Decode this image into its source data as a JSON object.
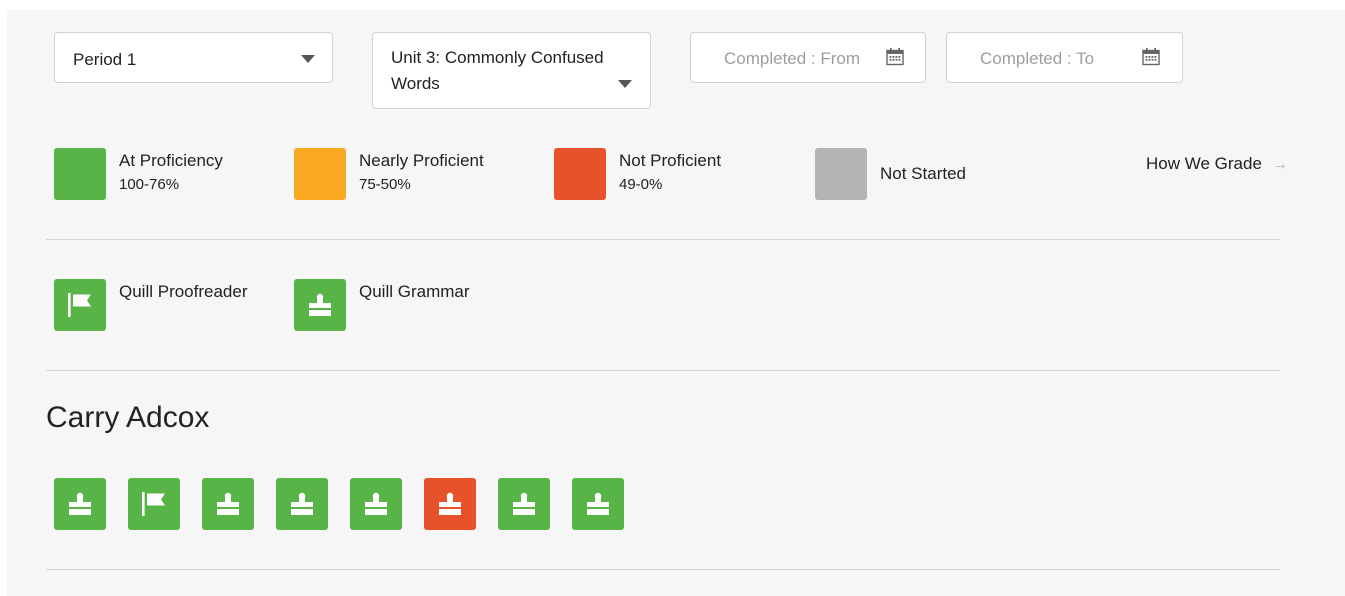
{
  "filters": {
    "classroom": {
      "value": "Period 1"
    },
    "unit": {
      "value_line1": "Unit 3: Commonly Confused",
      "value_line2": "Words"
    },
    "completed_from": {
      "placeholder": "Completed : From"
    },
    "completed_to": {
      "placeholder": "Completed : To"
    }
  },
  "colors": {
    "proficient": "#58b446",
    "nearly_proficient": "#f9a824",
    "not_proficient": "#e8522a",
    "not_started": "#b4b4b4",
    "divider": "#d6d6d6",
    "panel_bg": "#f6f6f6"
  },
  "legend": {
    "items": [
      {
        "label": "At Proficiency",
        "range": "100-76%",
        "color": "#58b446"
      },
      {
        "label": "Nearly Proficient",
        "range": "75-50%",
        "color": "#f9a824"
      },
      {
        "label": "Not Proficient",
        "range": "49-0%",
        "color": "#e8522a"
      },
      {
        "label": "Not Started",
        "color": "#b4b4b4"
      }
    ],
    "how_we_grade": "How We Grade",
    "how_we_grade_arrow": "→"
  },
  "activity_types": [
    {
      "label": "Quill Proofreader",
      "icon": "flag-icon"
    },
    {
      "label": "Quill Grammar",
      "icon": "puzzle-icon"
    }
  ],
  "student": {
    "name": "Carry Adcox",
    "activities": [
      {
        "icon": "puzzle-icon",
        "status": "proficient"
      },
      {
        "icon": "flag-icon",
        "status": "proficient"
      },
      {
        "icon": "puzzle-icon",
        "status": "proficient"
      },
      {
        "icon": "puzzle-icon",
        "status": "proficient"
      },
      {
        "icon": "puzzle-icon",
        "status": "proficient"
      },
      {
        "icon": "puzzle-icon",
        "status": "not_proficient"
      },
      {
        "icon": "puzzle-icon",
        "status": "proficient"
      },
      {
        "icon": "puzzle-icon",
        "status": "proficient"
      }
    ]
  }
}
